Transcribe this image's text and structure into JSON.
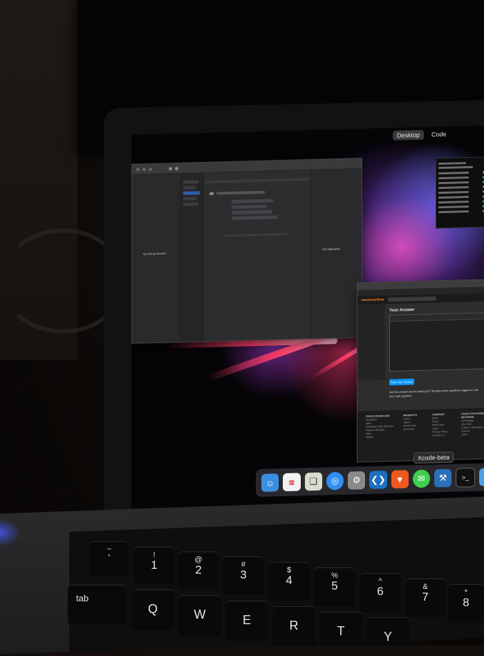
{
  "scene": "Photo of a MacBook in a dark room showing macOS desktop",
  "menubar": {
    "segments": [
      {
        "label": "Desktop",
        "active": true
      },
      {
        "label": "Code",
        "active": false
      }
    ]
  },
  "xcode": {
    "left_pane_text": "No Debug Session",
    "right_pane_text": "Not Applicable"
  },
  "browser": {
    "site_logo": "stackoverflow",
    "answer_heading": "Your Answer",
    "post_button_label": "Post Your Answer",
    "note": "Not the answer you're looking for? Browse other questions tagged or ask your own question.",
    "footer_columns": [
      {
        "title": "STACK OVERFLOW",
        "items": [
          "Questions",
          "Jobs",
          "Developer Jobs Directory",
          "Salary Calculator",
          "Help",
          "Mobile"
        ]
      },
      {
        "title": "PRODUCTS",
        "items": [
          "Teams",
          "Talent",
          "Advertising",
          "Enterprise"
        ]
      },
      {
        "title": "COMPANY",
        "items": [
          "About",
          "Press",
          "Work Here",
          "Legal",
          "Privacy Policy",
          "Contact Us"
        ]
      },
      {
        "title": "STACK EXCHANGE NETWORK",
        "items": [
          "Technology",
          "Life / Arts",
          "Culture / Recreation",
          "Science",
          "Other"
        ]
      }
    ]
  },
  "dock": {
    "tooltip": "Xcode-beta",
    "icons": [
      "finder-icon",
      "calendar-icon",
      "preview-icon",
      "safari-icon",
      "system-preferences-icon",
      "vscode-icon",
      "brave-icon",
      "messages-icon",
      "xcode-icon",
      "terminal-icon",
      "simulator-icon"
    ]
  },
  "keyboard": {
    "number_row": [
      {
        "top": "~",
        "bot": "`"
      },
      {
        "top": "!",
        "bot": "1"
      },
      {
        "top": "@",
        "bot": "2"
      },
      {
        "top": "#",
        "bot": "3"
      },
      {
        "top": "$",
        "bot": "4"
      },
      {
        "top": "%",
        "bot": "5"
      },
      {
        "top": "^",
        "bot": "6"
      },
      {
        "top": "&",
        "bot": "7"
      },
      {
        "top": "*",
        "bot": "8"
      }
    ],
    "tab_label": "tab",
    "letter_row": [
      "Q",
      "W",
      "E",
      "R",
      "T",
      "Y"
    ]
  }
}
